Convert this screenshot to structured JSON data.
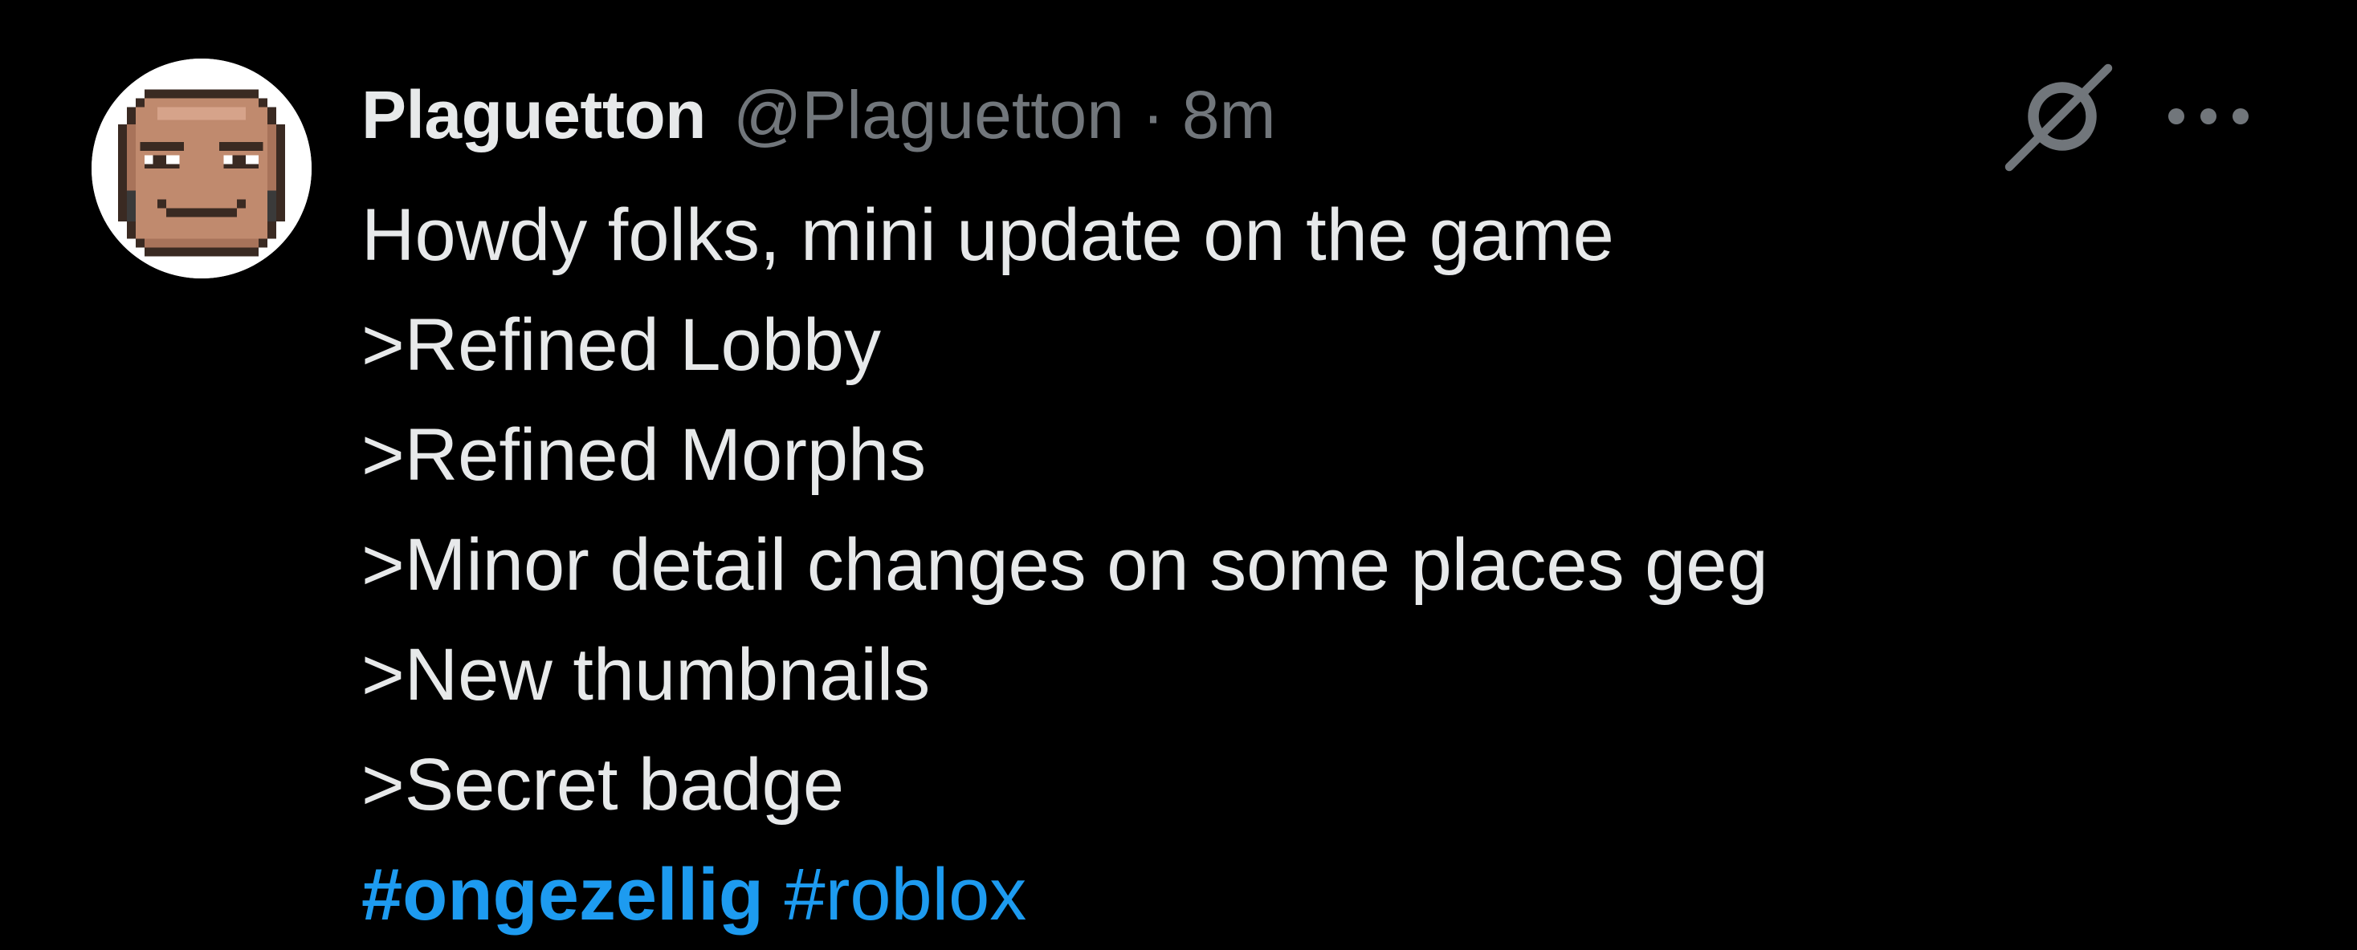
{
  "author": {
    "display_name": "Plaguetton",
    "handle": "@Plaguetton",
    "separator": "·",
    "time": "8m",
    "avatar_icon": "pixel-face-avatar"
  },
  "actions": {
    "grok_icon": "slashed-circle-icon",
    "more_icon": "more-dots-icon"
  },
  "tweet": {
    "lines": [
      "Howdy folks, mini update on the game",
      ">Refined Lobby",
      ">Refined Morphs",
      ">Minor detail changes on some places geg",
      ">New thumbnails",
      ">Secret badge"
    ],
    "hashtags": [
      {
        "text": "#ongezellig",
        "bold": true
      },
      {
        "text": "#roblox",
        "bold": false
      }
    ]
  },
  "colors": {
    "background": "#000000",
    "text_primary": "#e7e9ea",
    "text_secondary": "#71767b",
    "link": "#1d9bf0"
  }
}
